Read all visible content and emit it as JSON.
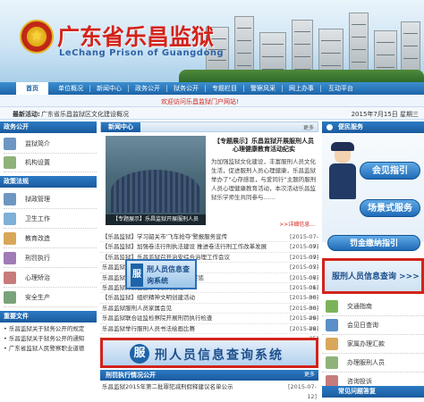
{
  "site": {
    "title_cn": "广东省乐昌监狱",
    "title_en": "LeChang Prison of Guangdong",
    "welcome": "欢迎访问乐昌监狱门户网站!"
  },
  "nav": [
    "首页",
    "单位概况",
    "新闻中心",
    "政务公开",
    "狱务公开",
    "专题栏目",
    "警察风采",
    "网上办事",
    "互动平台"
  ],
  "crumb": {
    "label": "最新活动:",
    "path": "广东省乐昌监狱区文化建设概况",
    "date": "2015年7月15日 星期三"
  },
  "left": {
    "gov_head": "政务公开",
    "gov_items": [
      "监狱简介",
      "机构设置"
    ],
    "topic_head": "政策法规",
    "topic_items": [
      "狱政管理",
      "卫生工作",
      "教育改造",
      "刑罚执行",
      "心理矫治",
      "安全生产"
    ],
    "news_head": "重要文件",
    "news_items": [
      "• 乐昌监狱关于狱务公开的规定",
      "• 乐昌监狱关于狱务公开的通知",
      "• 广东省监狱人民警察职业道德"
    ]
  },
  "middle": {
    "head": "新闻中心",
    "more": "更多",
    "feature_caption": "【专题展示】乐昌监狱开展服刑人员",
    "feature_title": "【专题展示】乐昌监狱开展服刑人员心理健康教育活动纪实",
    "feature_body": "为加强监狱文化建设，丰富服刑人员文化生活，促进服刑人员心理健康，乐昌监狱举办了“心存感恩，与爱同行”主题的服刑人员心理健康教育活动，本次活动乐昌监狱乐学师生共同参与……",
    "detail": ">>详细信息...",
    "list": [
      {
        "t": "【乐昌监狱】学习韶关市'飞车抢夺'警报服务宣传",
        "d": "[2015-07-09]"
      },
      {
        "t": "【乐昌监狱】加强卷法行刑执法建设 推进卷法行刑工作改革发展",
        "d": "[2015-07-09]"
      },
      {
        "t": "【乐昌监狱】乐昌监狱召开治安综合治理工作会议",
        "d": "[2015-07-05]"
      },
      {
        "t": "乐昌监狱收到一面锦旗",
        "d": "[2015-07-06]"
      },
      {
        "t": "乐昌监狱举行2015年第一季度罪犯奖惩",
        "d": "[2015-07-01]"
      },
      {
        "t": "乐昌监狱开展自主学习系列活动",
        "d": "[2015-06-30]"
      },
      {
        "t": "【乐昌监狱】组织精神文明创建活动",
        "d": "[2015-06-30]"
      },
      {
        "t": "乐昌监狱服刑人员家属会见",
        "d": "[2015-06-29]"
      },
      {
        "t": "乐昌监狱联合驻监检察院开展刑罚执行检查",
        "d": "[2015-06-29]"
      },
      {
        "t": "乐昌监狱举行服刑人员书法绘画比赛",
        "d": "[2015-06-25]"
      }
    ],
    "float_query_a": "服",
    "float_query": "刑人员信息查询系统",
    "big_query_logo": "服",
    "big_query": "刑人员信息查询系统",
    "bottom_head": "刑罚执行情况公开",
    "bottom_more": "更多",
    "bottom_row": {
      "t": "乐昌监狱2015年第二批罪犯减刑假释建议名单公示",
      "d": "[2015-07-12]"
    }
  },
  "right": {
    "head": "便民服务",
    "btn1": "会见指引",
    "btn2": "场景式服务",
    "btn3": "罚金缴纳指引",
    "query": "服刑人员信息查询 >>>",
    "menu": [
      "交通指南",
      "会见日查询",
      "家属办理汇款",
      "办理服刑人员",
      "咨询投诉"
    ],
    "footer_head": "常见问题答复"
  },
  "colors": {
    "brand_red": "#d3231b",
    "nav_blue": "#1d64a8"
  }
}
